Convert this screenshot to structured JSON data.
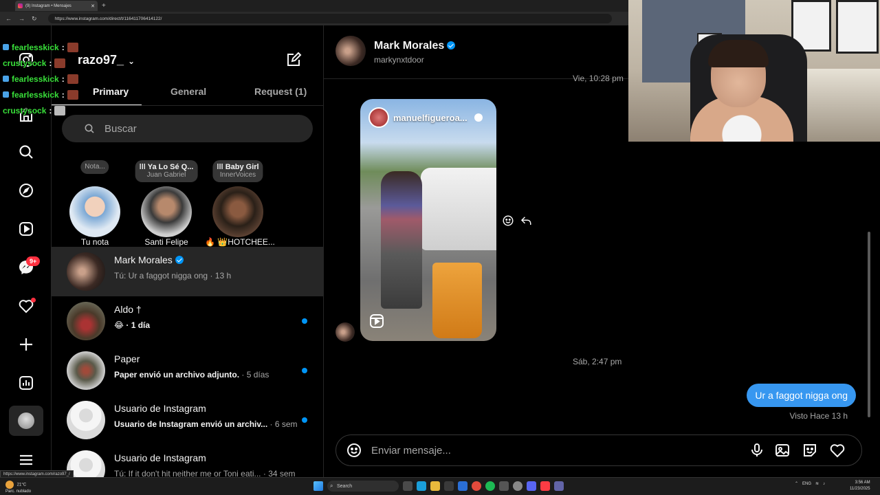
{
  "browser": {
    "tab_title": "(9) Instagram • Mensajes",
    "url": "https://www.instagram.com/direct/t/116411706414122/",
    "status_url": "https://www.instagram.com/razo97_/"
  },
  "inbox": {
    "username": "razo97_",
    "tabs": [
      "Primary",
      "General",
      "Request (1)"
    ],
    "search_placeholder": "Buscar",
    "notes": [
      {
        "bubble_title": "Nota...",
        "bubble_sub": "",
        "label": "Tu nota"
      },
      {
        "bubble_title": "Ya Lo Sé Q...",
        "bubble_sub": "Juan Gabriel",
        "label": "Santi Felipe"
      },
      {
        "bubble_title": "Baby Girl",
        "bubble_sub": "InnerVoices",
        "label": "🔥 👑HOTCHEE..."
      }
    ],
    "threads": [
      {
        "name": "Mark Morales",
        "preview": "Tú: Ur a faggot nigga ong",
        "time": "· 13 h",
        "verified": true,
        "unread": false,
        "active": true
      },
      {
        "name": "Aldo †",
        "preview": "😂",
        "time": "· 1 día",
        "verified": false,
        "unread": true,
        "active": false
      },
      {
        "name": "Paper",
        "preview": "Paper envió un archivo adjunto.",
        "time": "· 5 días",
        "verified": false,
        "unread": true,
        "active": false
      },
      {
        "name": "Usuario de Instagram",
        "preview": "Usuario de Instagram envió un archiv...",
        "time": "· 6 sem",
        "verified": false,
        "unread": true,
        "active": false
      },
      {
        "name": "Usuario de Instagram",
        "preview": "Tú: If it don't hit neither me or Toni eati...",
        "time": "· 34 sem",
        "verified": false,
        "unread": false,
        "active": false
      }
    ]
  },
  "rail": {
    "notifications_badge": "9+"
  },
  "chat": {
    "name": "Mark Morales",
    "handle": "markynxtdoor",
    "timestamp_top": "Vie, 10:28 pm",
    "reel_author": "manuelfigueroa...",
    "timestamp_mid": "Sáb, 2:47 pm",
    "my_message": "Ur a faggot nigga ong",
    "seen": "Visto Hace 13 h",
    "composer_placeholder": "Enviar mensaje..."
  },
  "stream_chat": [
    {
      "user": "fearlesskick",
      "sep": ":"
    },
    {
      "user": "crustysock",
      "sep": ":"
    },
    {
      "user": "fearlesskick",
      "sep": ":"
    },
    {
      "user": "fearlesskick",
      "sep": ":"
    },
    {
      "user": "crustysock",
      "sep": ":"
    }
  ],
  "taskbar": {
    "weather_temp": "21°C",
    "weather_desc": "Parc. nublado",
    "search": "Search",
    "lang": "ENG",
    "time": "3:56 AM",
    "date": "11/23/2025"
  },
  "colors": {
    "accent": "#0095f6",
    "bubble_me": "#3797f0",
    "badge": "#ff3040",
    "bg": "#000000"
  }
}
